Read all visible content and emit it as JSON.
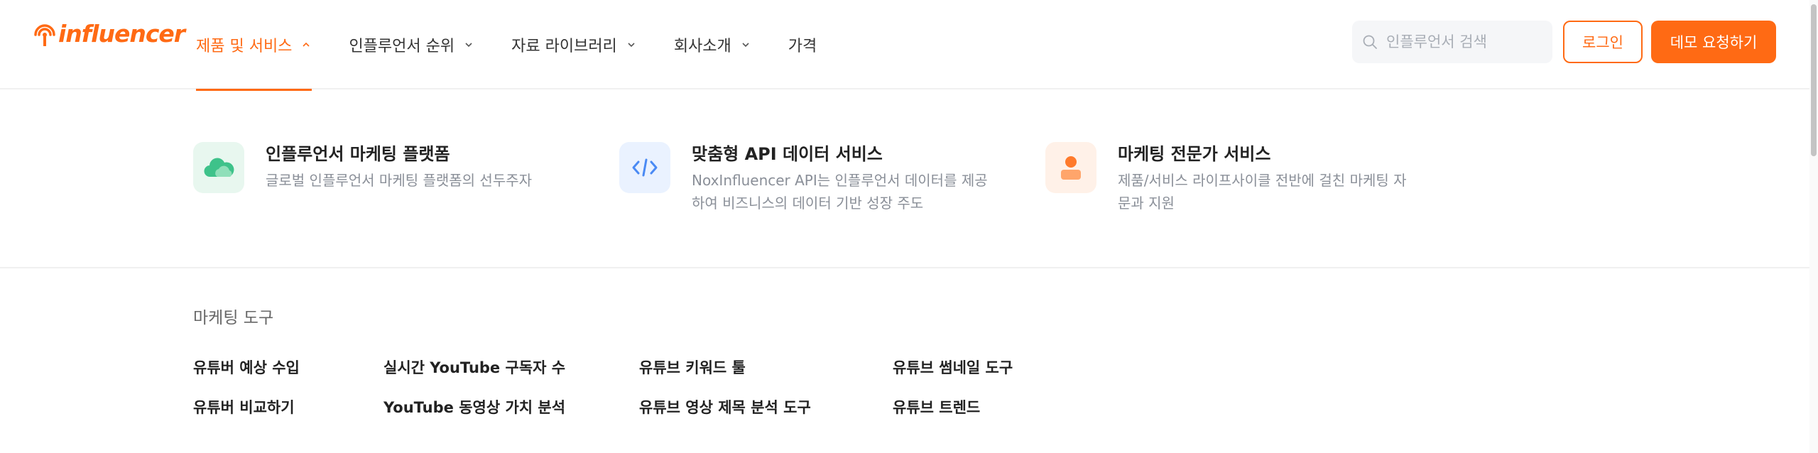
{
  "brand": {
    "logo_text": "influencer",
    "accent": "#ff6a14"
  },
  "nav": {
    "items": [
      {
        "label": "제품 및 서비스",
        "icon": "chevron-up-icon"
      },
      {
        "label": "인플루언서 순위",
        "icon": "chevron-down-icon"
      },
      {
        "label": "자료 라이브러리",
        "icon": "chevron-down-icon"
      },
      {
        "label": "회사소개",
        "icon": "chevron-down-icon"
      },
      {
        "label": "가격"
      }
    ]
  },
  "search": {
    "placeholder": "인플루언서 검색",
    "icon": "search-icon"
  },
  "buttons": {
    "login": "로그인",
    "demo": "데모 요청하기"
  },
  "services": [
    {
      "title": "인플루언서 마케팅 플랫폼",
      "desc1": "글로벌 인플루언서 마케팅 플랫폼의 선두주자",
      "desc2": "",
      "icon": "cloud-icon",
      "icon_bg": "#e8f7ef",
      "icon_color": "#3ec28a"
    },
    {
      "title": "맞춤형 API 데이터 서비스",
      "desc1": "NoxInfluencer API는 인플루언서 데이터를 제공",
      "desc2": "하여 비즈니스의 데이터 기반 성장 주도",
      "icon": "code-icon",
      "icon_bg": "#eaf2ff",
      "icon_color": "#4a8af4"
    },
    {
      "title": "마케팅 전문가 서비스",
      "desc1": "제품/서비스 라이프사이클 전반에 걸친 마케팅 자",
      "desc2": "문과 지원",
      "icon": "person-icon",
      "icon_bg": "#fff1e8",
      "icon_color": "#ff7a2b"
    }
  ],
  "tools": {
    "title": "마케팅 도구",
    "links": [
      "유튜버 예상 수입",
      "실시간 YouTube 구독자 수",
      "유튜브 키워드 툴",
      "유튜브 썸네일 도구",
      "유튜버 비교하기",
      "YouTube 동영상 가치 분석",
      "유튜브 영상 제목 분석 도구",
      "유튜브 트렌드"
    ]
  }
}
